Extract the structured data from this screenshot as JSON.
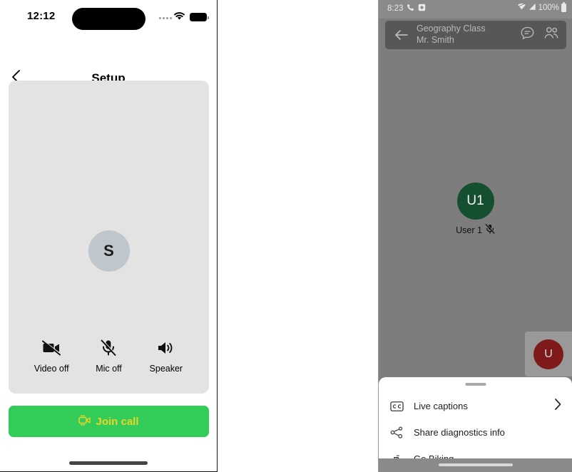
{
  "left_phone": {
    "status_bar": {
      "time": "12:12",
      "icons": [
        "cellular-dots-icon",
        "wifi-icon",
        "battery-icon"
      ]
    },
    "nav": {
      "back_icon": "chevron-left-icon",
      "title": "Setup"
    },
    "preview": {
      "avatar_initial": "S",
      "avatar_color": "#bfc6cc",
      "panel_color": "#e3e3e3"
    },
    "controls": [
      {
        "icon": "video-off-icon",
        "label": "Video off"
      },
      {
        "icon": "mic-off-icon",
        "label": "Mic off"
      },
      {
        "icon": "speaker-icon",
        "label": "Speaker"
      }
    ],
    "join_button": {
      "label": "Join call",
      "icon": "video-camera-icon",
      "background": "#33cc59",
      "text_color": "#e8d52b"
    },
    "home_indicator": true
  },
  "right_phone": {
    "status_bar": {
      "time": "8:23",
      "left_icons": [
        "phone-icon",
        "app-badge-icon"
      ],
      "battery_percent": "100%",
      "right_icons": [
        "wifi-icon",
        "signal-icon",
        "battery-icon"
      ]
    },
    "header": {
      "back_icon": "arrow-left-icon",
      "title": "Geography Class",
      "subtitle": "Mr. Smith",
      "actions": [
        {
          "icon": "chat-icon",
          "name": "chat-button"
        },
        {
          "icon": "people-icon",
          "name": "participants-button"
        }
      ]
    },
    "stage": {
      "background": "#7d7d7d",
      "participant": {
        "initials": "U1",
        "avatar_color": "#14502f",
        "name": "User 1",
        "muted_icon": "mic-off-icon"
      },
      "self_view": {
        "initial": "U",
        "avatar_color": "#7e1a1a",
        "tile_color": "#999999"
      }
    },
    "bottom_sheet": {
      "items": [
        {
          "icon": "closed-captions-icon",
          "label": "Live captions",
          "trailing_icon": "chevron-right-icon"
        },
        {
          "icon": "share-icon",
          "label": "Share diagnostics info",
          "trailing_icon": ""
        },
        {
          "icon": "bicycle-icon",
          "label": "Go Biking",
          "trailing_icon": ""
        }
      ]
    },
    "nav_bar": true
  }
}
